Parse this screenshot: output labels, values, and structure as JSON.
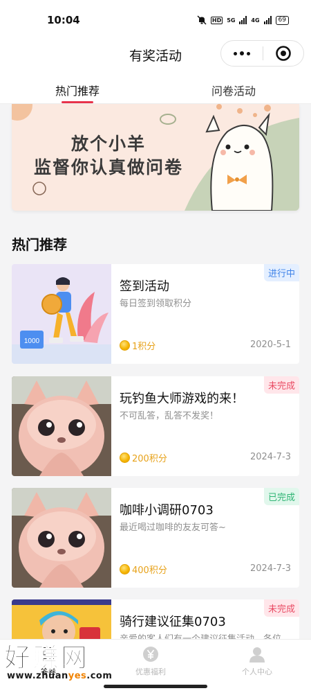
{
  "status_bar": {
    "time": "10:04",
    "hd": "HD",
    "sig1": "5G",
    "sig2": "4G",
    "battery": "69"
  },
  "nav": {
    "title": "有奖活动"
  },
  "tabs": [
    {
      "label": "热门推荐"
    },
    {
      "label": "问卷活动"
    }
  ],
  "banner": {
    "line1": "放个小羊",
    "line2": "监督你认真做问卷"
  },
  "section": {
    "title": "热门推荐"
  },
  "cards": [
    {
      "title": "签到活动",
      "desc": "每日签到领取积分",
      "points": "1积分",
      "date": "2020-5-1",
      "badge": "进行中",
      "thumb_text": "1000"
    },
    {
      "title": "玩钓鱼大师游戏的来！",
      "desc": "不可乱答，乱答不发奖！",
      "points": "200积分",
      "date": "2024-7-3",
      "badge": "未完成"
    },
    {
      "title": "咖啡小调研0703",
      "desc": "最近喝过咖啡的友友可答~",
      "points": "400积分",
      "date": "2024-7-3",
      "badge": "已完成"
    },
    {
      "title": "骑行建议征集0703",
      "desc": "亲爱的客人们有一个建议征集活动，各位",
      "badge": "未完成"
    }
  ],
  "tabbar": [
    {
      "label": "答卷"
    },
    {
      "label": "优惠福利"
    },
    {
      "label": "个人中心"
    }
  ],
  "watermark": {
    "text": "好赚网",
    "url_prefix": "www.zhuan",
    "url_highlight": "yes",
    "url_suffix": ".com"
  },
  "colors": {
    "accent": "#e8334a",
    "points": "#e7a21a",
    "in_progress": "#3f83e8",
    "undone": "#e94a63",
    "done": "#2fb574"
  }
}
